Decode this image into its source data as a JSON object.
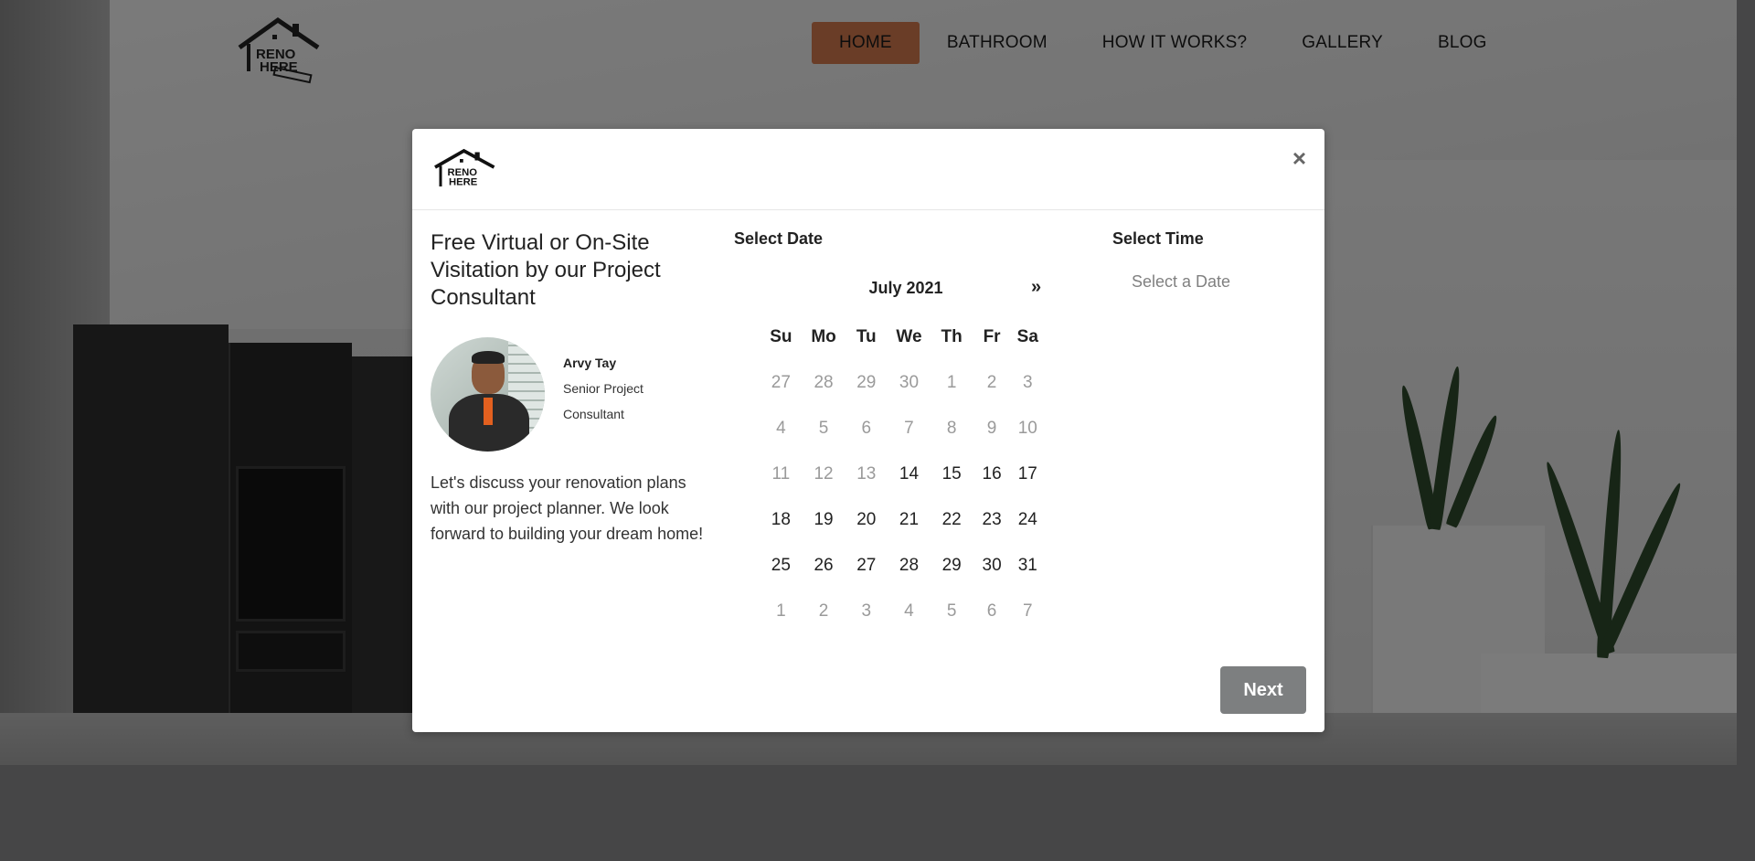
{
  "colors": {
    "accent": "#c97b4a",
    "button": "#7d7f80",
    "muted_text": "#9a9a9a"
  },
  "nav": {
    "logo_text": "RENO HERE",
    "items": [
      {
        "label": "HOME",
        "active": true
      },
      {
        "label": "BATHROOM",
        "active": false
      },
      {
        "label": "HOW IT WORKS?",
        "active": false
      },
      {
        "label": "GALLERY",
        "active": false
      },
      {
        "label": "BLOG",
        "active": false
      }
    ]
  },
  "modal": {
    "logo_text": "RENO HERE",
    "close_icon": "×",
    "offer": {
      "title": "Free Virtual or On-Site Visitation by our Project Consultant",
      "consultant_name": "Arvy Tay",
      "consultant_role": "Senior Project Consultant",
      "description": "Let's discuss your renovation plans with our project planner. We look forward to building your dream home!"
    },
    "date": {
      "label": "Select Date",
      "month": "July 2021",
      "next_icon": "»",
      "weekdays": [
        "Su",
        "Mo",
        "Tu",
        "We",
        "Th",
        "Fr",
        "Sa"
      ],
      "weeks": [
        [
          {
            "d": "27",
            "on": false
          },
          {
            "d": "28",
            "on": false
          },
          {
            "d": "29",
            "on": false
          },
          {
            "d": "30",
            "on": false
          },
          {
            "d": "1",
            "on": false
          },
          {
            "d": "2",
            "on": false
          },
          {
            "d": "3",
            "on": false
          }
        ],
        [
          {
            "d": "4",
            "on": false
          },
          {
            "d": "5",
            "on": false
          },
          {
            "d": "6",
            "on": false
          },
          {
            "d": "7",
            "on": false
          },
          {
            "d": "8",
            "on": false
          },
          {
            "d": "9",
            "on": false
          },
          {
            "d": "10",
            "on": false
          }
        ],
        [
          {
            "d": "11",
            "on": false
          },
          {
            "d": "12",
            "on": false
          },
          {
            "d": "13",
            "on": false
          },
          {
            "d": "14",
            "on": true
          },
          {
            "d": "15",
            "on": true
          },
          {
            "d": "16",
            "on": true
          },
          {
            "d": "17",
            "on": true
          }
        ],
        [
          {
            "d": "18",
            "on": true
          },
          {
            "d": "19",
            "on": true
          },
          {
            "d": "20",
            "on": true
          },
          {
            "d": "21",
            "on": true
          },
          {
            "d": "22",
            "on": true
          },
          {
            "d": "23",
            "on": true
          },
          {
            "d": "24",
            "on": true
          }
        ],
        [
          {
            "d": "25",
            "on": true
          },
          {
            "d": "26",
            "on": true
          },
          {
            "d": "27",
            "on": true
          },
          {
            "d": "28",
            "on": true
          },
          {
            "d": "29",
            "on": true
          },
          {
            "d": "30",
            "on": true
          },
          {
            "d": "31",
            "on": true
          }
        ],
        [
          {
            "d": "1",
            "on": false
          },
          {
            "d": "2",
            "on": false
          },
          {
            "d": "3",
            "on": false
          },
          {
            "d": "4",
            "on": false
          },
          {
            "d": "5",
            "on": false
          },
          {
            "d": "6",
            "on": false
          },
          {
            "d": "7",
            "on": false
          }
        ]
      ]
    },
    "time": {
      "label": "Select Time",
      "placeholder": "Select a Date"
    },
    "next_label": "Next"
  }
}
